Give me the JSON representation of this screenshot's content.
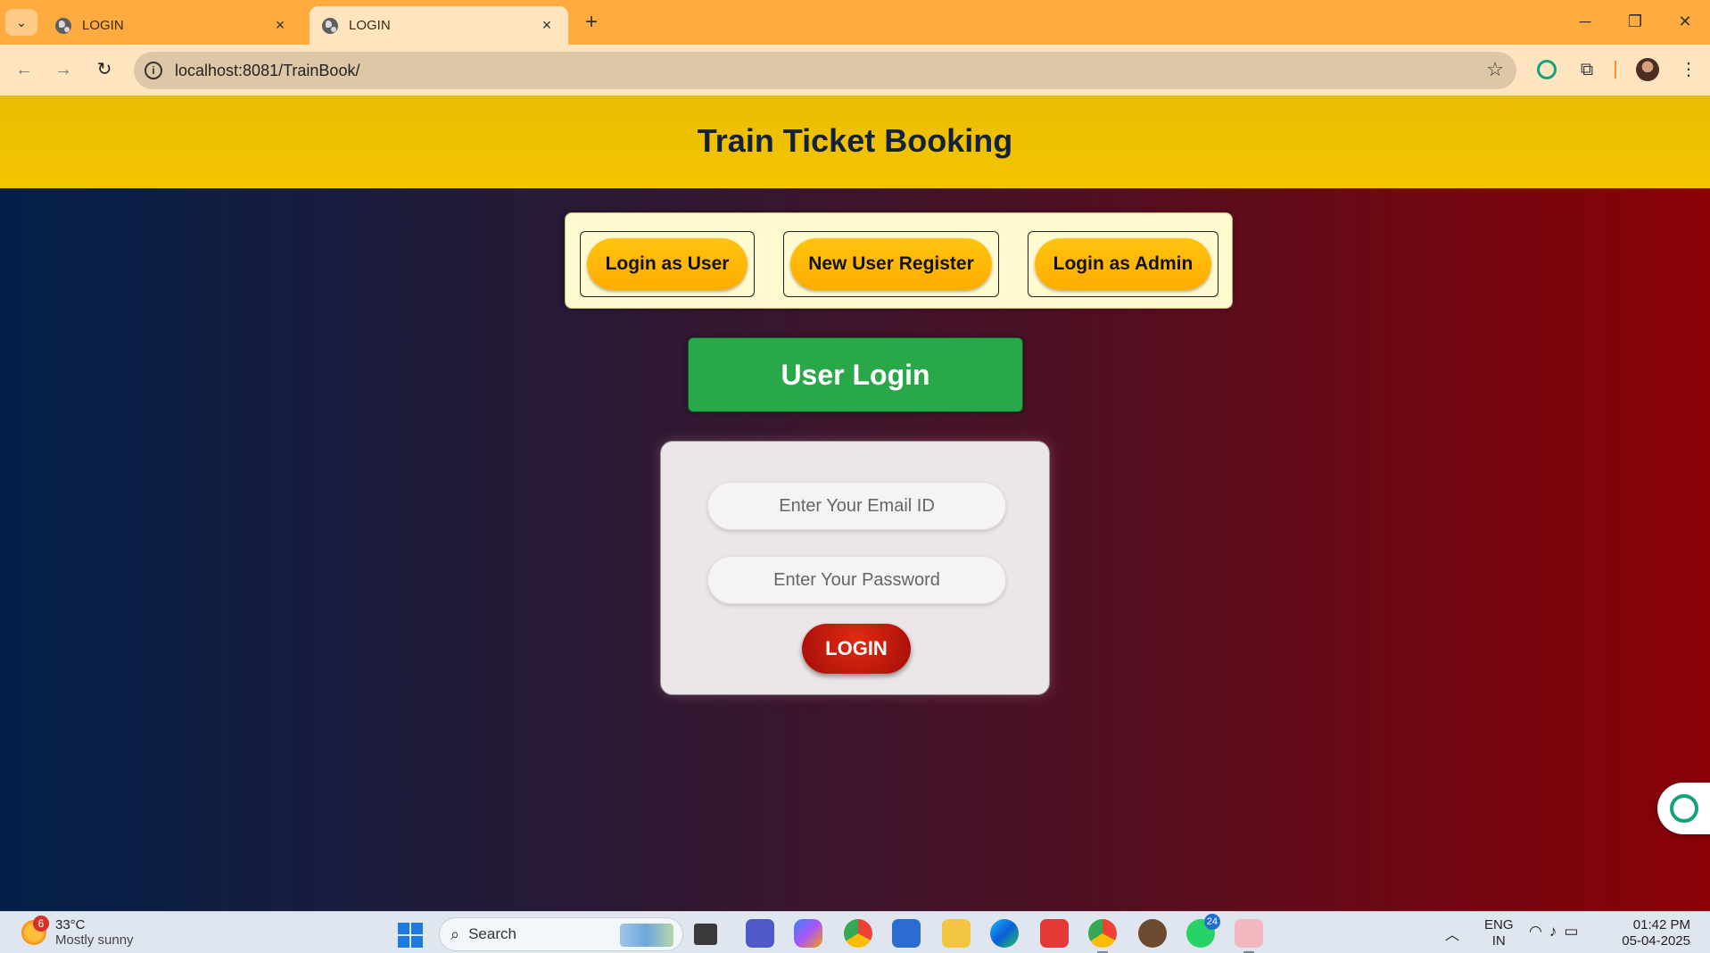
{
  "browser": {
    "tabs": [
      {
        "title": "LOGIN",
        "active": false
      },
      {
        "title": "LOGIN",
        "active": true
      }
    ],
    "url": "localhost:8081/TrainBook/",
    "window_controls": {
      "minimize": "─",
      "restore": "❐",
      "close": "✕"
    },
    "nav": {
      "back": "←",
      "forward": "→",
      "reload": "↻"
    }
  },
  "page": {
    "title": "Train Ticket Booking",
    "role_buttons": [
      "Login as User",
      "New User Register",
      "Login as Admin"
    ],
    "form_heading": "User Login",
    "email_placeholder": "Enter Your Email ID",
    "password_placeholder": "Enter Your Password",
    "submit_label": "LOGIN"
  },
  "taskbar": {
    "weather": {
      "temp": "33°C",
      "desc": "Mostly sunny",
      "badge": "6"
    },
    "search_label": "Search",
    "whatsapp_badge": "24",
    "language": {
      "line1": "ENG",
      "line2": "IN"
    },
    "time": "01:42 PM",
    "date": "05-04-2025"
  },
  "colors": {
    "header_bar": "#f0c400",
    "title_text": "#14213d",
    "role_button": "#ffb800",
    "heading_green": "#29a84a",
    "login_red": "#c0180c",
    "bg_left": "#03204a",
    "bg_right": "#8a0106"
  }
}
